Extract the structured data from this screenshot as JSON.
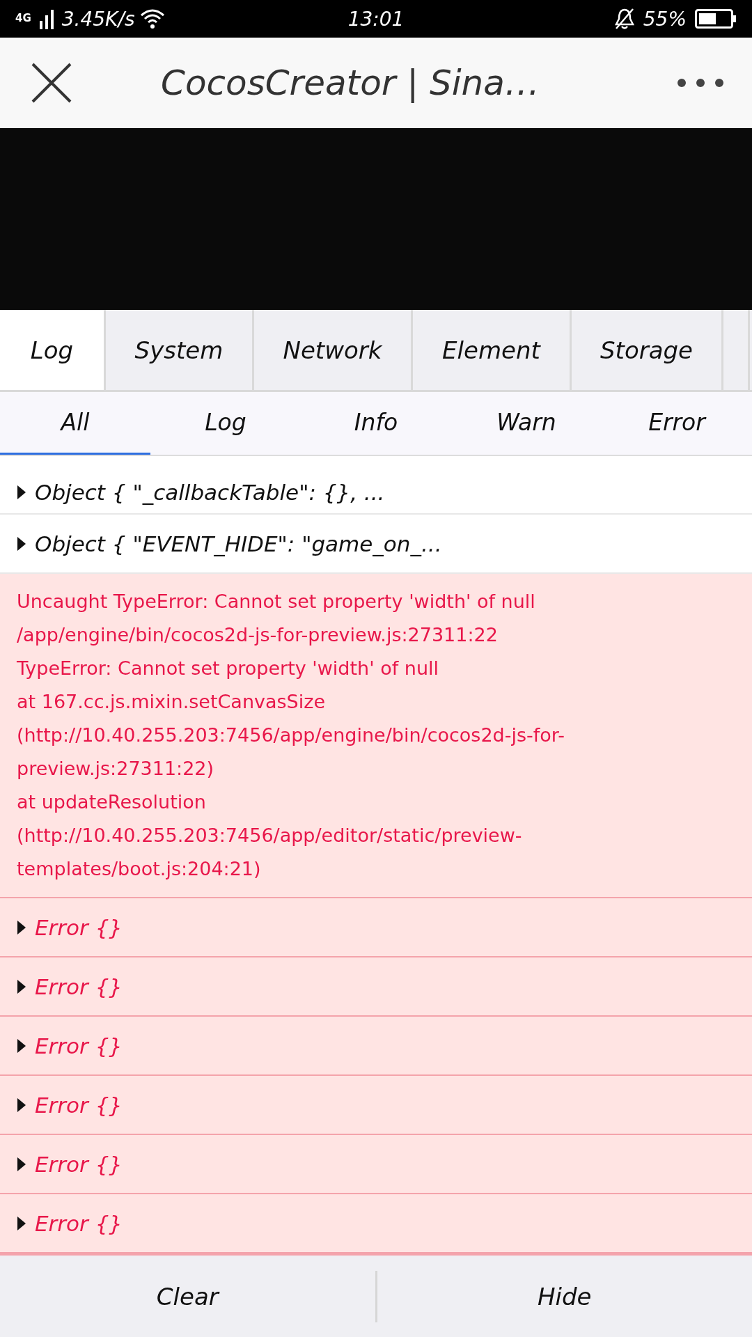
{
  "status_bar": {
    "network": "4G",
    "speed": "3.45K/s",
    "time": "13:01",
    "battery": "55%"
  },
  "title_bar": {
    "title": "CocosCreator | Sina…"
  },
  "tabs": [
    {
      "label": "Log",
      "selected": true
    },
    {
      "label": "System",
      "selected": false
    },
    {
      "label": "Network",
      "selected": false
    },
    {
      "label": "Element",
      "selected": false
    },
    {
      "label": "Storage",
      "selected": false
    }
  ],
  "filters": [
    {
      "label": "All",
      "selected": true
    },
    {
      "label": "Log",
      "selected": false
    },
    {
      "label": "Info",
      "selected": false
    },
    {
      "label": "Warn",
      "selected": false
    },
    {
      "label": "Error",
      "selected": false
    }
  ],
  "logs": [
    {
      "kind": "log",
      "expanded": false,
      "lines": [
        "Object { \"_callbackTable\": {}, ..."
      ]
    },
    {
      "kind": "log",
      "expanded": false,
      "lines": [
        "Object { \"EVENT_HIDE\": \"game_on_..."
      ]
    },
    {
      "kind": "error",
      "lines": [
        "Uncaught TypeError: Cannot set property 'width' of null",
        "/app/engine/bin/cocos2d-js-for-preview.js:27311:22",
        "TypeError: Cannot set property 'width' of null",
        "at 167.cc.js.mixin.setCanvasSize",
        "(http://10.40.255.203:7456/app/engine/bin/cocos2d-js-for-",
        "preview.js:27311:22)",
        "at updateResolution",
        "(http://10.40.255.203:7456/app/editor/static/preview-",
        "templates/boot.js:204:21)"
      ]
    },
    {
      "kind": "error",
      "expanded": false,
      "lines": [
        "Error {}"
      ]
    },
    {
      "kind": "error",
      "expanded": false,
      "lines": [
        "Error {}"
      ]
    },
    {
      "kind": "error",
      "expanded": false,
      "lines": [
        "Error {}"
      ]
    },
    {
      "kind": "error",
      "expanded": false,
      "lines": [
        "Error {}"
      ]
    },
    {
      "kind": "error",
      "expanded": false,
      "lines": [
        "Error {}"
      ]
    },
    {
      "kind": "error",
      "expanded": false,
      "lines": [
        "Error {}"
      ]
    }
  ],
  "footer": {
    "buttons": [
      "Clear",
      "Hide"
    ]
  }
}
